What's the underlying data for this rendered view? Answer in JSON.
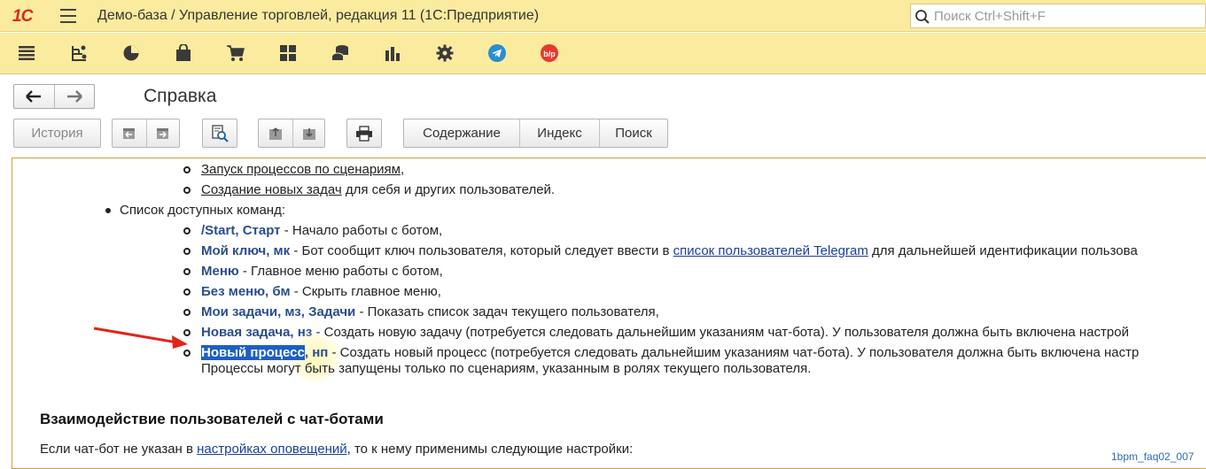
{
  "app": {
    "logo": "1С",
    "title": "Демо-база / Управление торговлей, редакция 11  (1С:Предприятие)"
  },
  "search": {
    "placeholder": "Поиск Ctrl+Shift+F"
  },
  "sections": [
    "menu-icon",
    "org-chart-icon",
    "pie-chart-icon",
    "shopping-bag-icon",
    "cart-icon",
    "grid-icon",
    "coins-icon",
    "bar-chart-icon",
    "gear-icon",
    "telegram-icon",
    "bpm-icon"
  ],
  "form": {
    "title": "Справка"
  },
  "toolbar": {
    "history": "История",
    "contents": "Содержание",
    "index": "Индекс",
    "search": "Поиск"
  },
  "content": {
    "l1_link": "Запуск процессов по сценариям",
    "l1_rest": ",",
    "l2_link": "Создание новых задач",
    "l2_rest": " для себя и других пользователей.",
    "l3": "Список доступных команд:",
    "l4_cmd1": "/Start",
    "l4_sep": ", ",
    "l4_cmd2": "Старт",
    "l4_rest": " - Начало работы с ботом,",
    "l5_cmd": "Мой ключ, мк",
    "l5_mid": " - Бот сообщит ключ пользователя, который следует ввести в ",
    "l5_link": "список пользователей Telegram",
    "l5_rest": " для дальнейшей идентификации пользова",
    "l6_cmd": "Меню",
    "l6_rest": " - Главное меню работы с ботом,",
    "l7_cmd": "Без меню, бм",
    "l7_rest": " - Скрыть главное меню,",
    "l8_cmd1": "Мои задачи, мз",
    "l8_sep": ", ",
    "l8_cmd2": "Задачи",
    "l8_rest": " - Показать список задач текущего пользователя,",
    "l9_cmd": "Новая задача, нз",
    "l9_rest": " - Создать новую задачу (потребуется следовать дальнейшим указаниям чат-бота). У пользователя должна быть включена настрой",
    "l10_hl": "Новый процесс",
    "l10_cmd": ", нп",
    "l10_rest": " - Создать новый процесс (потребуется следовать дальнейшим указаниям чат-бота). У пользователя должна быть включена настр",
    "l11": "Процессы могут быть запущены только по сценариям, указанным в ролях текущего пользователя.",
    "heading": "Взаимодействие пользователей с чат-ботами",
    "l12_pre": "Если чат-бот не указан в ",
    "l12_link": "настройках оповещений",
    "l12_rest": ", то к нему применимы следующие настройки:"
  },
  "watermark": "1bpm_faq02_007",
  "colors": {
    "titlebar": "#fbeb9e",
    "command": "#2a4d8f",
    "highlight": "#1d5fc4",
    "arrow": "#e3231b"
  }
}
